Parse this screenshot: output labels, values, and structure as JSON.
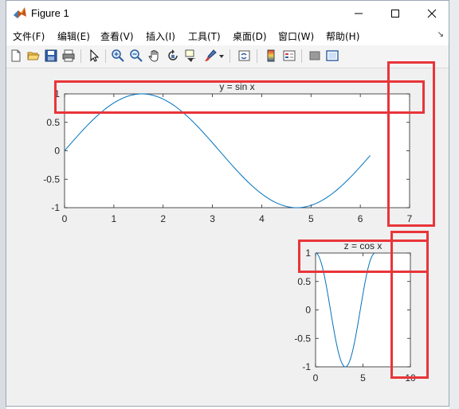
{
  "window": {
    "title": "Figure 1",
    "controls": [
      "minimize",
      "maximize",
      "close"
    ]
  },
  "menu": [
    {
      "label": "文件(F)"
    },
    {
      "label": "编辑(E)"
    },
    {
      "label": "查看(V)"
    },
    {
      "label": "插入(I)"
    },
    {
      "label": "工具(T)"
    },
    {
      "label": "桌面(D)"
    },
    {
      "label": "窗口(W)"
    },
    {
      "label": "帮助(H)"
    }
  ],
  "toolbar": {
    "icons": [
      "new-figure-icon",
      "open-file-icon",
      "save-icon",
      "print-icon",
      "edit-plot-arrow-icon",
      "zoom-in-icon",
      "zoom-out-icon",
      "pan-hand-icon",
      "rotate-3d-icon",
      "data-cursor-icon",
      "brush-icon",
      "link-plot-icon",
      "colorbar-icon",
      "legend-icon",
      "hide-plot-tools-icon",
      "show-plot-tools-icon"
    ]
  },
  "chart_data": [
    {
      "type": "line",
      "title": "y = sin x",
      "function": "sin",
      "x_range": [
        0,
        6.2
      ],
      "xlim": [
        0,
        7
      ],
      "ylim": [
        -1,
        1
      ],
      "xticks": [
        "0",
        "1",
        "2",
        "3",
        "4",
        "5",
        "6",
        "7"
      ],
      "yticks": [
        "-1",
        "-0.5",
        "0",
        "0.5",
        "1"
      ],
      "xlabel": "",
      "ylabel": "",
      "series": [
        {
          "color": "#0072bd"
        }
      ],
      "grid": false
    },
    {
      "type": "line",
      "title": "z = cos x",
      "function": "cos",
      "x_range": [
        0,
        6.2
      ],
      "xlim": [
        0,
        10
      ],
      "ylim": [
        -1,
        1
      ],
      "xticks": [
        "0",
        "5",
        "10"
      ],
      "yticks": [
        "-1",
        "-0.5",
        "0",
        "0.5",
        "1"
      ],
      "xlabel": "",
      "ylabel": "",
      "series": [
        {
          "color": "#0072bd"
        }
      ],
      "grid": false
    }
  ],
  "colors": {
    "annotation": "#e8353a",
    "line": "#0072bd",
    "figure_bg": "#f0f0f0"
  }
}
